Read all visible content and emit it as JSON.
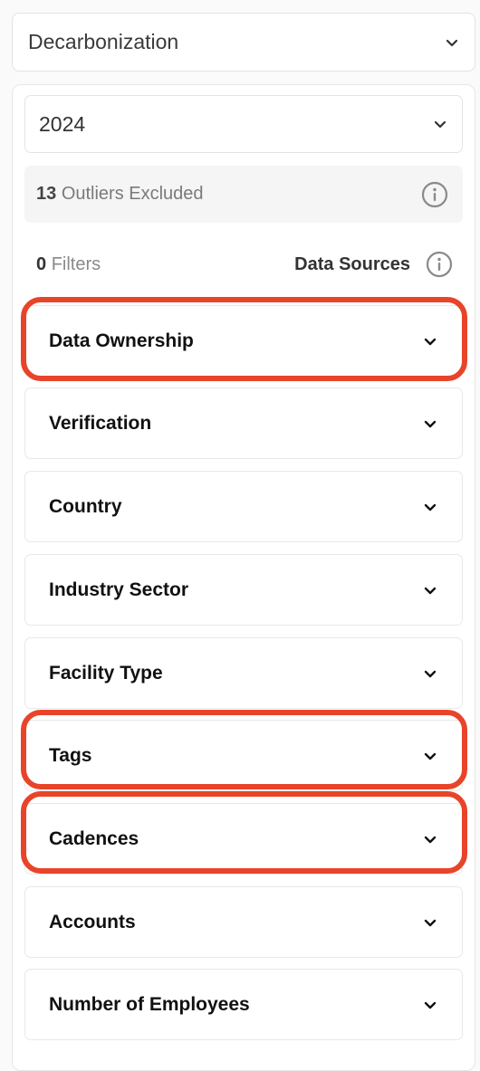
{
  "metric_select": {
    "value": "Decarbonization",
    "icon": "chevron-down-icon"
  },
  "year_select": {
    "value": "2024",
    "icon": "chevron-down-icon"
  },
  "outliers": {
    "count": "13",
    "text": "Outliers Excluded",
    "icon": "info-icon"
  },
  "filters": {
    "count": "0",
    "label": "Filters",
    "data_sources_label": "Data Sources",
    "icon": "info-icon"
  },
  "accordions": [
    {
      "label": "Data Ownership",
      "highlighted": true
    },
    {
      "label": "Verification",
      "highlighted": false
    },
    {
      "label": "Country",
      "highlighted": false
    },
    {
      "label": "Industry Sector",
      "highlighted": false
    },
    {
      "label": "Facility Type",
      "highlighted": false
    },
    {
      "label": "Tags",
      "highlighted": true
    },
    {
      "label": "Cadences",
      "highlighted": true
    },
    {
      "label": "Accounts",
      "highlighted": false
    },
    {
      "label": "Number of Employees",
      "highlighted": false
    }
  ],
  "colors": {
    "highlight": "#e8442a",
    "panel_bg": "#ffffff",
    "page_bg": "#fafafa"
  }
}
